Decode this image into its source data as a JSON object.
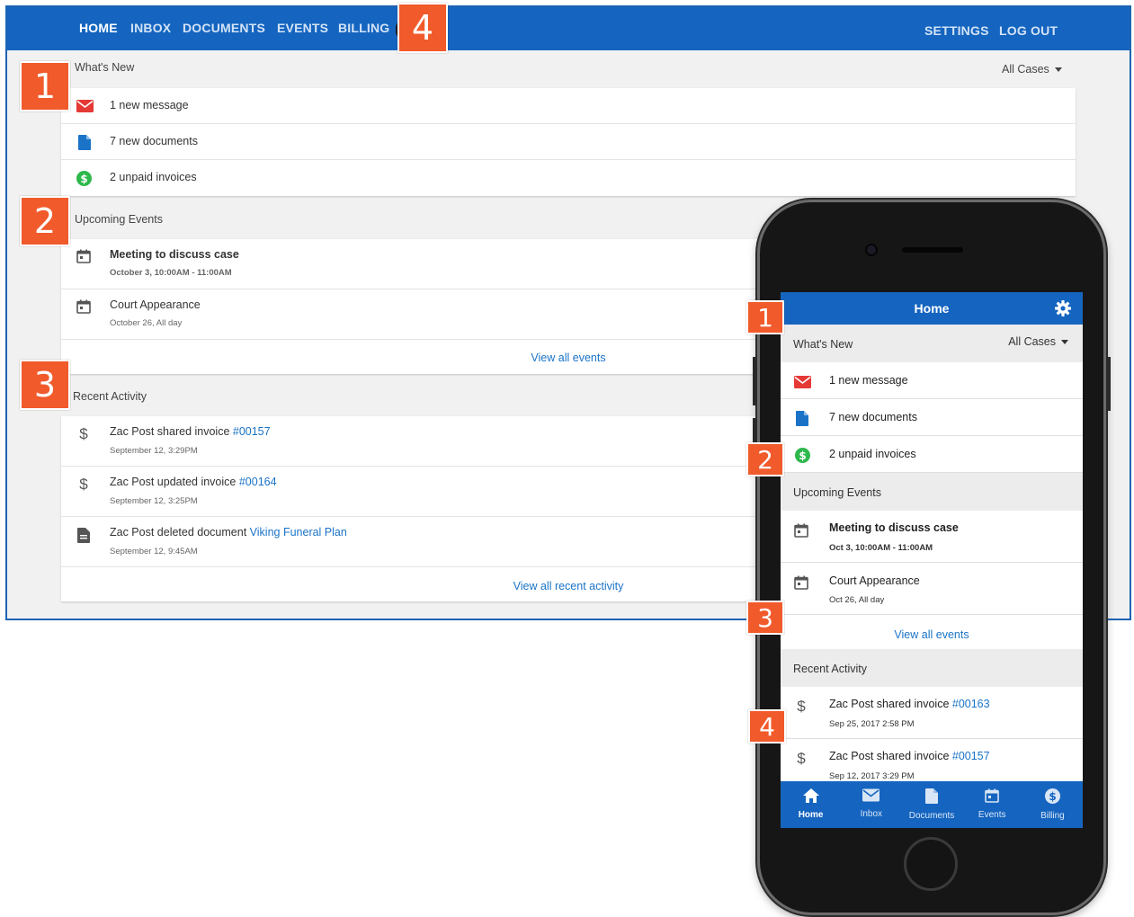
{
  "desktop": {
    "nav": {
      "left": [
        "HOME",
        "INBOX",
        "DOCUMENTS",
        "EVENTS",
        "BILLING"
      ],
      "right": [
        "SETTINGS",
        "LOG OUT"
      ]
    },
    "whats_new": {
      "title": "What's New",
      "filter": "All Cases",
      "items": [
        {
          "icon": "envelope-icon",
          "text": "1 new message"
        },
        {
          "icon": "document-icon",
          "text": "7 new documents"
        },
        {
          "icon": "dollar-circle-icon",
          "text": "2 unpaid invoices"
        }
      ]
    },
    "upcoming": {
      "title": "Upcoming Events",
      "items": [
        {
          "title": "Meeting to discuss case",
          "time": "October 3, 10:00AM - 11:00AM"
        },
        {
          "title": "Court Appearance",
          "time": "October 26, All day"
        }
      ],
      "view_all": "View all events"
    },
    "activity": {
      "title": "Recent Activity",
      "items": [
        {
          "icon": "dollar-icon",
          "prefix": "Zac Post shared invoice ",
          "link": "#00157",
          "time": "September 12, 3:29PM"
        },
        {
          "icon": "dollar-icon",
          "prefix": "Zac Post updated invoice ",
          "link": "#00164",
          "time": "September 12, 3:25PM"
        },
        {
          "icon": "document-icon",
          "prefix": "Zac Post deleted document ",
          "link": "Viking Funeral Plan",
          "time": "September 12, 9:45AM"
        }
      ],
      "view_all": "View all recent activity"
    }
  },
  "badges": {
    "desktop": [
      "1",
      "2",
      "3",
      "4"
    ],
    "mobile": [
      "1",
      "2",
      "3",
      "4"
    ]
  },
  "mobile": {
    "header": {
      "title": "Home"
    },
    "whats_new": {
      "title": "What's New",
      "filter": "All Cases",
      "items": [
        {
          "text": "1 new message"
        },
        {
          "text": "7 new documents"
        },
        {
          "text": "2 unpaid invoices"
        }
      ]
    },
    "upcoming": {
      "title": "Upcoming Events",
      "items": [
        {
          "title": "Meeting to discuss case",
          "time": "Oct 3, 10:00AM - 11:00AM"
        },
        {
          "title": "Court Appearance",
          "time": "Oct 26, All day"
        }
      ],
      "view_all": "View all events"
    },
    "activity": {
      "title": "Recent Activity",
      "items": [
        {
          "prefix": "Zac Post shared invoice ",
          "link": "#00163",
          "time": "Sep 25, 2017 2:58 PM"
        },
        {
          "prefix": "Zac Post shared invoice ",
          "link": "#00157",
          "time": "Sep 12, 2017 3:29 PM"
        }
      ]
    },
    "tabs": [
      {
        "label": "Home",
        "icon": "home-icon",
        "active": true
      },
      {
        "label": "Inbox",
        "icon": "envelope-icon"
      },
      {
        "label": "Documents",
        "icon": "document-icon"
      },
      {
        "label": "Events",
        "icon": "calendar-icon"
      },
      {
        "label": "Billing",
        "icon": "dollar-circle-icon"
      }
    ]
  },
  "colors": {
    "brand_blue": "#1565c0",
    "link_blue": "#1a73c7",
    "badge_orange": "#f15a2b",
    "message_red": "#e53935",
    "money_green": "#2db84b"
  }
}
